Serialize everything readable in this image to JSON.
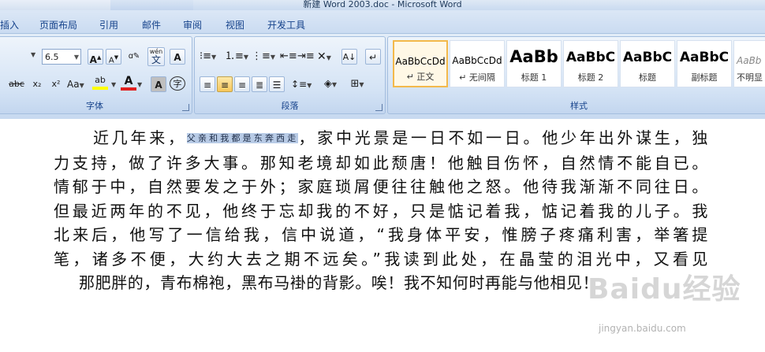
{
  "window": {
    "title": "新建 Word 2003.doc - Microsoft Word"
  },
  "tabs": [
    "插入",
    "页面布局",
    "引用",
    "邮件",
    "审阅",
    "视图",
    "开发工具"
  ],
  "font_group": {
    "label": "字体",
    "font_size": "6.5",
    "buttons": {
      "grow": "A",
      "shrink": "A",
      "change_case": "Aa",
      "strikethrough": "abc",
      "subscript": "x₂",
      "superscript": "x²",
      "text_highlight": "ab",
      "font_color": "A",
      "char_shading": "A",
      "enclose": "字",
      "pinyin": "wén",
      "char_border": "A"
    }
  },
  "paragraph_group": {
    "label": "段落"
  },
  "styles_group": {
    "label": "样式",
    "items": [
      {
        "preview": "AaBbCcDd",
        "name": "↵ 正文"
      },
      {
        "preview": "AaBbCcDd",
        "name": "↵ 无间隔"
      },
      {
        "preview": "AaBb",
        "name": "标题 1"
      },
      {
        "preview": "AaBbC",
        "name": "标题 2"
      },
      {
        "preview": "AaBbC",
        "name": "标题"
      },
      {
        "preview": "AaBbC",
        "name": "副标题"
      },
      {
        "preview": "AaBb",
        "name": "不明显"
      }
    ]
  },
  "document": {
    "selected": "父亲和我都是东奔西走",
    "line1_a": "近几年来，",
    "line1_b": "，家中光景是一日不如一日。他少年出外谋生，独",
    "lines": [
      "力支持，做了许多大事。那知老境却如此颓唐！他触目伤怀，自然情不能自已。",
      "情郁于中，自然要发之于外；家庭琐屑便往往触他之怒。他待我渐渐不同往日。",
      "但最近两年的不见，他终于忘却我的不好，只是惦记着我，惦记着我的儿子。我",
      "北来后，他写了一信给我，信中说道，“我身体平安，惟膀子疼痛利害，举箸提",
      "笔，诸多不便，大约大去之期不远矣。”我读到此处，在晶莹的泪光中，又看见"
    ],
    "last_line": "那肥胖的，青布棉袍，黑布马褂的背影。唉！我不知何时再能与他相见！"
  },
  "watermark": {
    "logo": "Baidu经验",
    "url": "jingyan.baidu.com"
  }
}
